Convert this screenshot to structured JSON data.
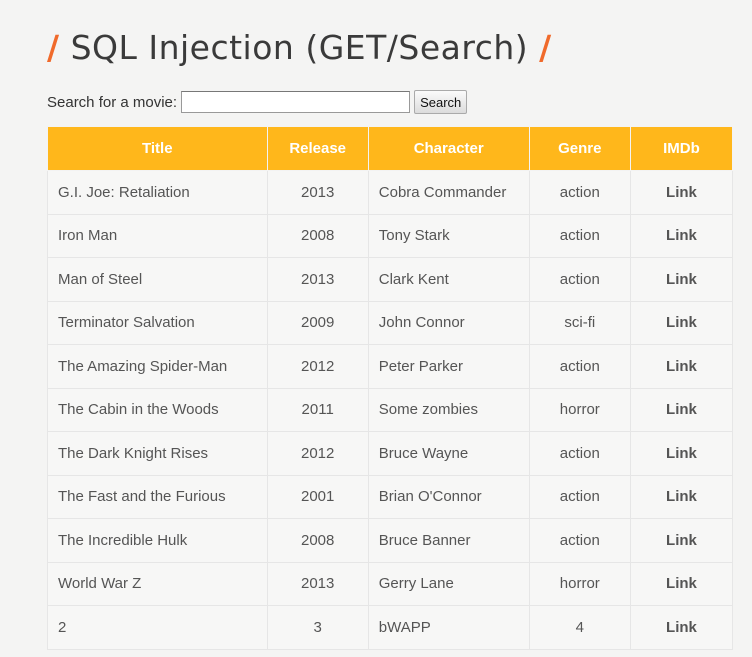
{
  "header": {
    "slash": "/",
    "title": "SQL Injection (GET/Search)"
  },
  "search": {
    "label": "Search for a movie:",
    "value": "",
    "button_label": "Search"
  },
  "table": {
    "columns": [
      "Title",
      "Release",
      "Character",
      "Genre",
      "IMDb"
    ],
    "rows": [
      {
        "title": "G.I. Joe: Retaliation",
        "release": "2013",
        "character": "Cobra Commander",
        "genre": "action",
        "imdb": "Link"
      },
      {
        "title": "Iron Man",
        "release": "2008",
        "character": "Tony Stark",
        "genre": "action",
        "imdb": "Link"
      },
      {
        "title": "Man of Steel",
        "release": "2013",
        "character": "Clark Kent",
        "genre": "action",
        "imdb": "Link"
      },
      {
        "title": "Terminator Salvation",
        "release": "2009",
        "character": "John Connor",
        "genre": "sci-fi",
        "imdb": "Link"
      },
      {
        "title": "The Amazing Spider-Man",
        "release": "2012",
        "character": "Peter Parker",
        "genre": "action",
        "imdb": "Link"
      },
      {
        "title": "The Cabin in the Woods",
        "release": "2011",
        "character": "Some zombies",
        "genre": "horror",
        "imdb": "Link"
      },
      {
        "title": "The Dark Knight Rises",
        "release": "2012",
        "character": "Bruce Wayne",
        "genre": "action",
        "imdb": "Link"
      },
      {
        "title": "The Fast and the Furious",
        "release": "2001",
        "character": "Brian O'Connor",
        "genre": "action",
        "imdb": "Link"
      },
      {
        "title": "The Incredible Hulk",
        "release": "2008",
        "character": "Bruce Banner",
        "genre": "action",
        "imdb": "Link"
      },
      {
        "title": "World War Z",
        "release": "2013",
        "character": "Gerry Lane",
        "genre": "horror",
        "imdb": "Link"
      },
      {
        "title": "2",
        "release": "3",
        "character": "bWAPP",
        "genre": "4",
        "imdb": "Link"
      }
    ]
  },
  "colors": {
    "header_bg": "#ffb71b",
    "accent_slash": "#f06a2b",
    "page_bg": "#f4f4f3"
  }
}
